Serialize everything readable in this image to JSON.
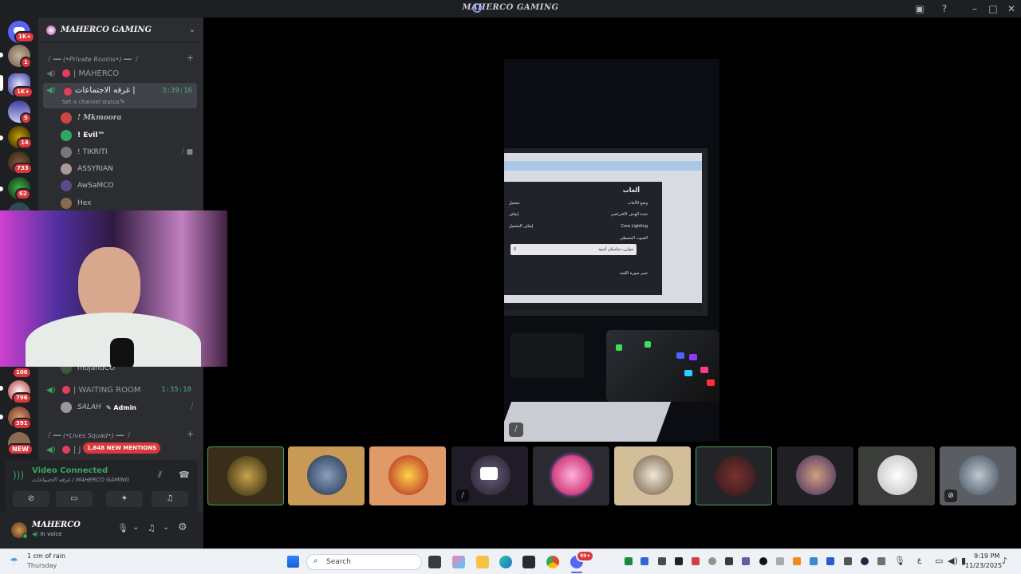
{
  "window": {
    "title": "MAHERCO GAMING"
  },
  "rail": {
    "badges": [
      "1K+",
      "1",
      "1K+",
      "5",
      "14",
      "733",
      "62",
      "106",
      "796",
      "391",
      "NEW"
    ],
    "new_mentions": "1,648 NEW MENTIONS"
  },
  "server": {
    "name": "MAHERCO GAMING"
  },
  "categories": {
    "private_rooms": "꒰ ━━ (•Private Rooms•) ━━ ꒱",
    "lives_squad": "꒰ ━━ (•Lives Squad•) ━━ ꒱"
  },
  "channels": {
    "maherco": {
      "label": "| MAHERCO"
    },
    "meeting": {
      "label": "غرفه الاجتماعات |",
      "timer": "3:39:16",
      "status": "Set a channel status"
    },
    "waiting": {
      "label": "| WAITING ROOM",
      "timer": "1:35:18"
    },
    "partial": {
      "label": "| J"
    }
  },
  "voice_users": [
    "! Mkmoora",
    "! Evil™",
    "! TIKRITI",
    "ASSYRIAN",
    "AwSaMCO",
    "Hex",
    "mojandCO"
  ],
  "waiting_users": [
    {
      "name": "SALAH",
      "tag": "Admin"
    }
  ],
  "voice_panel": {
    "status": "Video Connected",
    "channel": "غرفه الاجتماعات / MAHERCO GAMING"
  },
  "user": {
    "name": "MAHERCO",
    "status": "In voice"
  },
  "screen_content": {
    "menu_title": "ألعاب",
    "menu_items": [
      {
        "label": "وضع الألعاب",
        "value": "تشغيل"
      },
      {
        "label": "شدة الهدف الافتراضي",
        "value": "إيقاف"
      },
      {
        "label": "Core Lighting",
        "value": "إيقاف التشغيل"
      },
      {
        "label": "الصوت المحيطي",
        "value": ""
      },
      {
        "label": "موازن ديناميكي أسود",
        "value": "0"
      },
      {
        "label": "خبير صورة اللعبة",
        "value": ""
      }
    ]
  },
  "taskbar": {
    "weather": "1 cm of rain",
    "weather_day": "Thursday",
    "search_placeholder": "Search",
    "lang": "ع",
    "time": "9:19 PM",
    "date": "11/23/2025",
    "discord_badge": "99+"
  },
  "colors": {
    "accent_green": "#3ba55c",
    "mention_red": "#da373c",
    "rail_bg": "#1e1f22",
    "panel_bg": "#2b2d31"
  }
}
